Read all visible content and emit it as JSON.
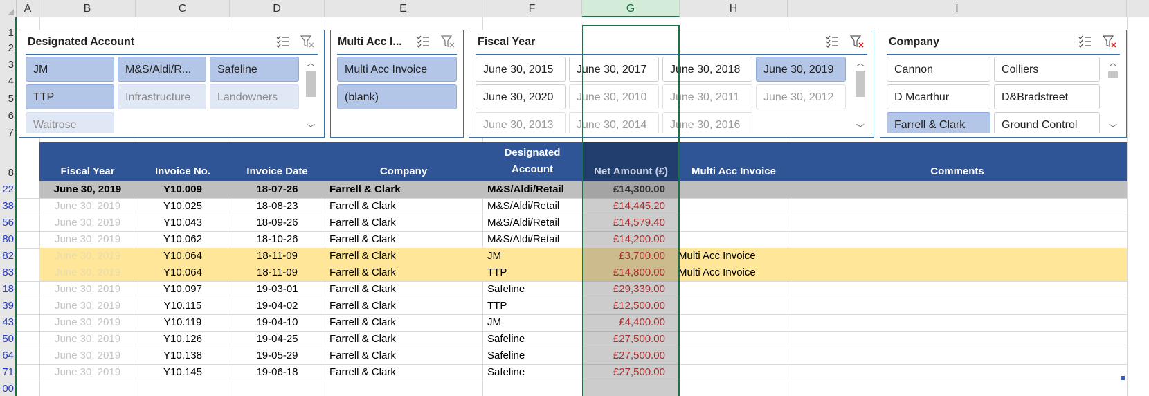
{
  "columns": [
    "A",
    "B",
    "C",
    "D",
    "E",
    "F",
    "G",
    "H",
    "I"
  ],
  "rows": [
    "1",
    "2",
    "3",
    "4",
    "5",
    "6",
    "7",
    "8",
    "22",
    "38",
    "56",
    "80",
    "82",
    "83",
    "18",
    "39",
    "43",
    "50",
    "64",
    "71",
    "00"
  ],
  "slicers": {
    "designated": {
      "title": "Designated Account",
      "items": [
        {
          "label": "JM",
          "state": "on"
        },
        {
          "label": "M&S/Aldi/R...",
          "state": "on"
        },
        {
          "label": "Safeline",
          "state": "on"
        },
        {
          "label": "TTP",
          "state": "on"
        },
        {
          "label": "Infrastructure",
          "state": "dim"
        },
        {
          "label": "Landowners",
          "state": "dim"
        },
        {
          "label": "Waitrose",
          "state": "dim"
        }
      ]
    },
    "multi": {
      "title": "Multi Acc I...",
      "items": [
        {
          "label": "Multi Acc Invoice",
          "state": "on"
        },
        {
          "label": "(blank)",
          "state": "on"
        }
      ]
    },
    "fiscal": {
      "title": "Fiscal Year",
      "items": [
        {
          "label": "June 30, 2015",
          "state": "off"
        },
        {
          "label": "June 30, 2017",
          "state": "off"
        },
        {
          "label": "June 30, 2018",
          "state": "off"
        },
        {
          "label": "June 30, 2019",
          "state": "on"
        },
        {
          "label": "June 30, 2020",
          "state": "off"
        },
        {
          "label": "June 30, 2010",
          "state": "gray"
        },
        {
          "label": "June 30, 2011",
          "state": "gray"
        },
        {
          "label": "June 30, 2012",
          "state": "gray"
        },
        {
          "label": "June 30, 2013",
          "state": "gray"
        },
        {
          "label": "June 30, 2014",
          "state": "gray"
        },
        {
          "label": "June 30, 2016",
          "state": "gray"
        }
      ]
    },
    "company": {
      "title": "Company",
      "items": [
        {
          "label": "Cannon",
          "state": "off"
        },
        {
          "label": "Colliers",
          "state": "off"
        },
        {
          "label": "D Mcarthur",
          "state": "off"
        },
        {
          "label": "D&Bradstreet",
          "state": "off"
        },
        {
          "label": "Farrell & Clark",
          "state": "on"
        },
        {
          "label": "Ground Control",
          "state": "off"
        }
      ]
    }
  },
  "table": {
    "headers": {
      "fiscal_year": "Fiscal Year",
      "invoice_no": "Invoice No.",
      "invoice_date": "Invoice Date",
      "company": "Company",
      "designated_1": "Designated",
      "designated_2": "Account",
      "net_amount": "Net Amount (£)",
      "multi_acc": "Multi Acc Invoice",
      "comments": "Comments"
    },
    "rows": [
      {
        "fy": "June 30, 2019",
        "inv": "Y10.009",
        "dt": "18-07-26",
        "co": "Farrell & Clark",
        "da": "M&S/Aldi/Retail",
        "na": "£14,300.00",
        "ma": "",
        "cm": "",
        "style": "bold"
      },
      {
        "fy": "June 30, 2019",
        "inv": "Y10.025",
        "dt": "18-08-23",
        "co": "Farrell & Clark",
        "da": "M&S/Aldi/Retail",
        "na": "£14,445.20",
        "ma": "",
        "cm": "",
        "style": ""
      },
      {
        "fy": "June 30, 2019",
        "inv": "Y10.043",
        "dt": "18-09-26",
        "co": "Farrell & Clark",
        "da": "M&S/Aldi/Retail",
        "na": "£14,579.40",
        "ma": "",
        "cm": "",
        "style": ""
      },
      {
        "fy": "June 30, 2019",
        "inv": "Y10.062",
        "dt": "18-10-26",
        "co": "Farrell & Clark",
        "da": "M&S/Aldi/Retail",
        "na": "£14,200.00",
        "ma": "",
        "cm": "",
        "style": ""
      },
      {
        "fy": "June 30, 2019",
        "inv": "Y10.064",
        "dt": "18-11-09",
        "co": "Farrell & Clark",
        "da": "JM",
        "na": "£3,700.00",
        "ma": "Multi Acc Invoice",
        "cm": "",
        "style": "hl"
      },
      {
        "fy": "June 30, 2019",
        "inv": "Y10.064",
        "dt": "18-11-09",
        "co": "Farrell & Clark",
        "da": "TTP",
        "na": "£14,800.00",
        "ma": "Multi Acc Invoice",
        "cm": "",
        "style": "hl"
      },
      {
        "fy": "June 30, 2019",
        "inv": "Y10.097",
        "dt": "19-03-01",
        "co": "Farrell & Clark",
        "da": "Safeline",
        "na": "£29,339.00",
        "ma": "",
        "cm": "",
        "style": ""
      },
      {
        "fy": "June 30, 2019",
        "inv": "Y10.115",
        "dt": "19-04-02",
        "co": "Farrell & Clark",
        "da": "TTP",
        "na": "£12,500.00",
        "ma": "",
        "cm": "",
        "style": ""
      },
      {
        "fy": "June 30, 2019",
        "inv": "Y10.119",
        "dt": "19-04-10",
        "co": "Farrell & Clark",
        "da": "JM",
        "na": "£4,400.00",
        "ma": "",
        "cm": "",
        "style": ""
      },
      {
        "fy": "June 30, 2019",
        "inv": "Y10.126",
        "dt": "19-04-25",
        "co": "Farrell & Clark",
        "da": "Safeline",
        "na": "£27,500.00",
        "ma": "",
        "cm": "",
        "style": ""
      },
      {
        "fy": "June 30, 2019",
        "inv": "Y10.138",
        "dt": "19-05-29",
        "co": "Farrell & Clark",
        "da": "Safeline",
        "na": "£27,500.00",
        "ma": "",
        "cm": "",
        "style": ""
      },
      {
        "fy": "June 30, 2019",
        "inv": "Y10.145",
        "dt": "19-06-18",
        "co": "Farrell & Clark",
        "da": "Safeline",
        "na": "£27,500.00",
        "ma": "",
        "cm": "",
        "style": ""
      }
    ]
  }
}
